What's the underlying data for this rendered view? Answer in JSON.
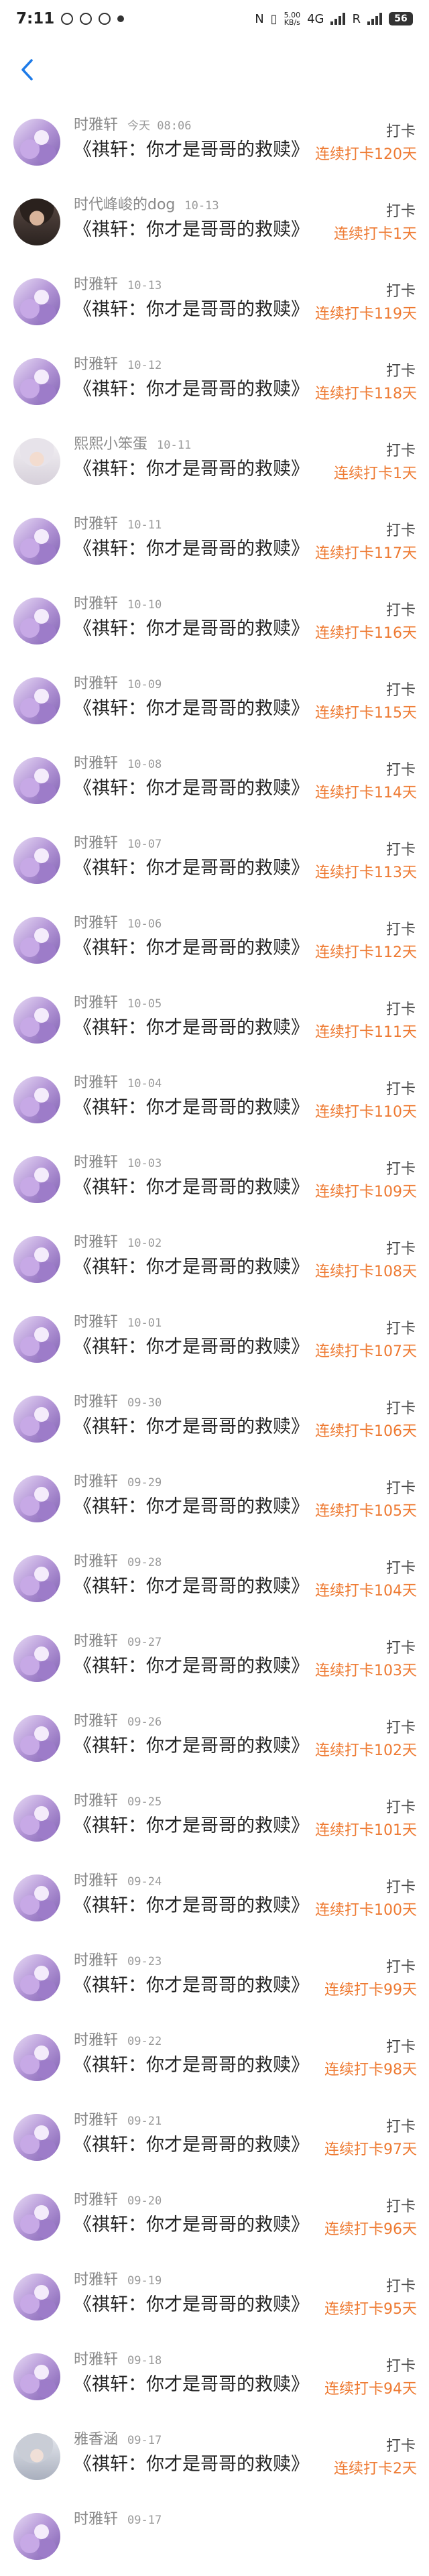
{
  "status_bar": {
    "time": "7:11",
    "network_speed": "5.00\nKB/s",
    "network_type": "4G",
    "carrier_r": "R",
    "battery": "56"
  },
  "colors": {
    "accent": "#ee7a32",
    "back": "#1e7be8"
  },
  "rows": [
    {
      "user": "时雅轩",
      "date": "今天 08:06",
      "title": "《祺轩：你才是哥哥的救赎》",
      "action": "打卡",
      "streak": "连续打卡120天",
      "avatar": "anime"
    },
    {
      "user": "时代峰峻的dog",
      "date": "10-13",
      "title": "《祺轩：你才是哥哥的救赎》",
      "action": "打卡",
      "streak": "连续打卡1天",
      "avatar": "dark"
    },
    {
      "user": "时雅轩",
      "date": "10-13",
      "title": "《祺轩：你才是哥哥的救赎》",
      "action": "打卡",
      "streak": "连续打卡119天",
      "avatar": "anime"
    },
    {
      "user": "时雅轩",
      "date": "10-12",
      "title": "《祺轩：你才是哥哥的救赎》",
      "action": "打卡",
      "streak": "连续打卡118天",
      "avatar": "anime"
    },
    {
      "user": "熙熙小笨蛋",
      "date": "10-11",
      "title": "《祺轩：你才是哥哥的救赎》",
      "action": "打卡",
      "streak": "连续打卡1天",
      "avatar": "light"
    },
    {
      "user": "时雅轩",
      "date": "10-11",
      "title": "《祺轩：你才是哥哥的救赎》",
      "action": "打卡",
      "streak": "连续打卡117天",
      "avatar": "anime"
    },
    {
      "user": "时雅轩",
      "date": "10-10",
      "title": "《祺轩：你才是哥哥的救赎》",
      "action": "打卡",
      "streak": "连续打卡116天",
      "avatar": "anime"
    },
    {
      "user": "时雅轩",
      "date": "10-09",
      "title": "《祺轩：你才是哥哥的救赎》",
      "action": "打卡",
      "streak": "连续打卡115天",
      "avatar": "anime"
    },
    {
      "user": "时雅轩",
      "date": "10-08",
      "title": "《祺轩：你才是哥哥的救赎》",
      "action": "打卡",
      "streak": "连续打卡114天",
      "avatar": "anime"
    },
    {
      "user": "时雅轩",
      "date": "10-07",
      "title": "《祺轩：你才是哥哥的救赎》",
      "action": "打卡",
      "streak": "连续打卡113天",
      "avatar": "anime"
    },
    {
      "user": "时雅轩",
      "date": "10-06",
      "title": "《祺轩：你才是哥哥的救赎》",
      "action": "打卡",
      "streak": "连续打卡112天",
      "avatar": "anime"
    },
    {
      "user": "时雅轩",
      "date": "10-05",
      "title": "《祺轩：你才是哥哥的救赎》",
      "action": "打卡",
      "streak": "连续打卡111天",
      "avatar": "anime"
    },
    {
      "user": "时雅轩",
      "date": "10-04",
      "title": "《祺轩：你才是哥哥的救赎》",
      "action": "打卡",
      "streak": "连续打卡110天",
      "avatar": "anime"
    },
    {
      "user": "时雅轩",
      "date": "10-03",
      "title": "《祺轩：你才是哥哥的救赎》",
      "action": "打卡",
      "streak": "连续打卡109天",
      "avatar": "anime"
    },
    {
      "user": "时雅轩",
      "date": "10-02",
      "title": "《祺轩：你才是哥哥的救赎》",
      "action": "打卡",
      "streak": "连续打卡108天",
      "avatar": "anime"
    },
    {
      "user": "时雅轩",
      "date": "10-01",
      "title": "《祺轩：你才是哥哥的救赎》",
      "action": "打卡",
      "streak": "连续打卡107天",
      "avatar": "anime"
    },
    {
      "user": "时雅轩",
      "date": "09-30",
      "title": "《祺轩：你才是哥哥的救赎》",
      "action": "打卡",
      "streak": "连续打卡106天",
      "avatar": "anime"
    },
    {
      "user": "时雅轩",
      "date": "09-29",
      "title": "《祺轩：你才是哥哥的救赎》",
      "action": "打卡",
      "streak": "连续打卡105天",
      "avatar": "anime"
    },
    {
      "user": "时雅轩",
      "date": "09-28",
      "title": "《祺轩：你才是哥哥的救赎》",
      "action": "打卡",
      "streak": "连续打卡104天",
      "avatar": "anime"
    },
    {
      "user": "时雅轩",
      "date": "09-27",
      "title": "《祺轩：你才是哥哥的救赎》",
      "action": "打卡",
      "streak": "连续打卡103天",
      "avatar": "anime"
    },
    {
      "user": "时雅轩",
      "date": "09-26",
      "title": "《祺轩：你才是哥哥的救赎》",
      "action": "打卡",
      "streak": "连续打卡102天",
      "avatar": "anime"
    },
    {
      "user": "时雅轩",
      "date": "09-25",
      "title": "《祺轩：你才是哥哥的救赎》",
      "action": "打卡",
      "streak": "连续打卡101天",
      "avatar": "anime"
    },
    {
      "user": "时雅轩",
      "date": "09-24",
      "title": "《祺轩：你才是哥哥的救赎》",
      "action": "打卡",
      "streak": "连续打卡100天",
      "avatar": "anime"
    },
    {
      "user": "时雅轩",
      "date": "09-23",
      "title": "《祺轩：你才是哥哥的救赎》",
      "action": "打卡",
      "streak": "连续打卡99天",
      "avatar": "anime"
    },
    {
      "user": "时雅轩",
      "date": "09-22",
      "title": "《祺轩：你才是哥哥的救赎》",
      "action": "打卡",
      "streak": "连续打卡98天",
      "avatar": "anime"
    },
    {
      "user": "时雅轩",
      "date": "09-21",
      "title": "《祺轩：你才是哥哥的救赎》",
      "action": "打卡",
      "streak": "连续打卡97天",
      "avatar": "anime"
    },
    {
      "user": "时雅轩",
      "date": "09-20",
      "title": "《祺轩：你才是哥哥的救赎》",
      "action": "打卡",
      "streak": "连续打卡96天",
      "avatar": "anime"
    },
    {
      "user": "时雅轩",
      "date": "09-19",
      "title": "《祺轩：你才是哥哥的救赎》",
      "action": "打卡",
      "streak": "连续打卡95天",
      "avatar": "anime"
    },
    {
      "user": "时雅轩",
      "date": "09-18",
      "title": "《祺轩：你才是哥哥的救赎》",
      "action": "打卡",
      "streak": "连续打卡94天",
      "avatar": "anime"
    },
    {
      "user": "雅香涵",
      "date": "09-17",
      "title": "《祺轩：你才是哥哥的救赎》",
      "action": "打卡",
      "streak": "连续打卡2天",
      "avatar": "silver"
    },
    {
      "user": "时雅轩",
      "date": "09-17",
      "title": "",
      "action": "",
      "streak": "",
      "avatar": "anime"
    }
  ]
}
